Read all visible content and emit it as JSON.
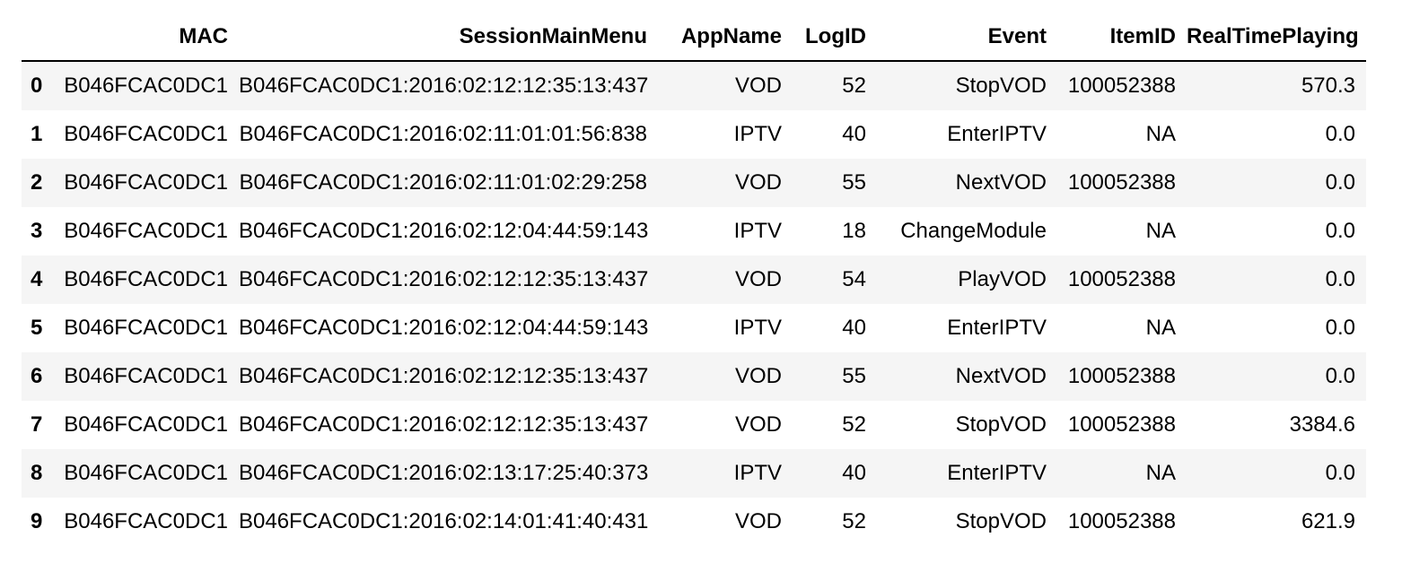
{
  "table": {
    "index_header": "",
    "columns": [
      "MAC",
      "SessionMainMenu",
      "AppName",
      "LogID",
      "Event",
      "ItemID",
      "RealTimePlaying"
    ],
    "rows": [
      {
        "index": "0",
        "cells": [
          "B046FCAC0DC1",
          "B046FCAC0DC1:2016:02:12:12:35:13:437",
          "VOD",
          "52",
          "StopVOD",
          "100052388",
          "570.3"
        ]
      },
      {
        "index": "1",
        "cells": [
          "B046FCAC0DC1",
          "B046FCAC0DC1:2016:02:11:01:01:56:838",
          "IPTV",
          "40",
          "EnterIPTV",
          "NA",
          "0.0"
        ]
      },
      {
        "index": "2",
        "cells": [
          "B046FCAC0DC1",
          "B046FCAC0DC1:2016:02:11:01:02:29:258",
          "VOD",
          "55",
          "NextVOD",
          "100052388",
          "0.0"
        ]
      },
      {
        "index": "3",
        "cells": [
          "B046FCAC0DC1",
          "B046FCAC0DC1:2016:02:12:04:44:59:143",
          "IPTV",
          "18",
          "ChangeModule",
          "NA",
          "0.0"
        ]
      },
      {
        "index": "4",
        "cells": [
          "B046FCAC0DC1",
          "B046FCAC0DC1:2016:02:12:12:35:13:437",
          "VOD",
          "54",
          "PlayVOD",
          "100052388",
          "0.0"
        ]
      },
      {
        "index": "5",
        "cells": [
          "B046FCAC0DC1",
          "B046FCAC0DC1:2016:02:12:04:44:59:143",
          "IPTV",
          "40",
          "EnterIPTV",
          "NA",
          "0.0"
        ]
      },
      {
        "index": "6",
        "cells": [
          "B046FCAC0DC1",
          "B046FCAC0DC1:2016:02:12:12:35:13:437",
          "VOD",
          "55",
          "NextVOD",
          "100052388",
          "0.0"
        ]
      },
      {
        "index": "7",
        "cells": [
          "B046FCAC0DC1",
          "B046FCAC0DC1:2016:02:12:12:35:13:437",
          "VOD",
          "52",
          "StopVOD",
          "100052388",
          "3384.6"
        ]
      },
      {
        "index": "8",
        "cells": [
          "B046FCAC0DC1",
          "B046FCAC0DC1:2016:02:13:17:25:40:373",
          "IPTV",
          "40",
          "EnterIPTV",
          "NA",
          "0.0"
        ]
      },
      {
        "index": "9",
        "cells": [
          "B046FCAC0DC1",
          "B046FCAC0DC1:2016:02:14:01:41:40:431",
          "VOD",
          "52",
          "StopVOD",
          "100052388",
          "621.9"
        ]
      }
    ]
  }
}
